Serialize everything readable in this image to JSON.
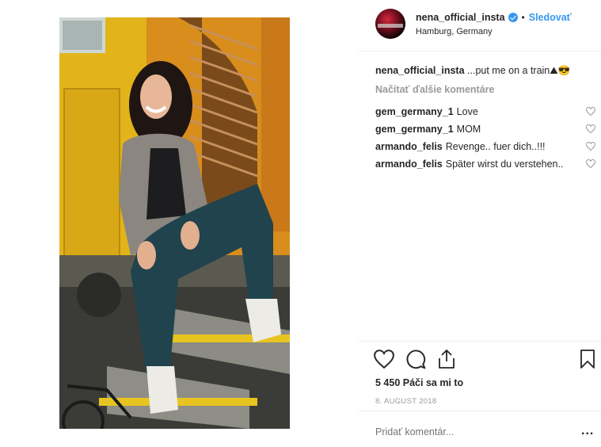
{
  "post": {
    "username": "nena_official_insta",
    "dot": "•",
    "follow_label": "Sledovať",
    "location": "Hamburg, Germany",
    "caption_text": "...put me on a train",
    "caption_emoji": "⛰😎",
    "load_more": "Načítať ďalšie komentáre",
    "comments": [
      {
        "user": "gem_germany_1",
        "text": "Love"
      },
      {
        "user": "gem_germany_1",
        "text": "MOM"
      },
      {
        "user": "armando_felis",
        "text": "Revenge.. fuer dich..!!!"
      },
      {
        "user": "armando_felis",
        "text": "Später wirst du verstehen.."
      }
    ],
    "likes": "5 450 Páči sa mi to",
    "date": "8. AUGUST 2018",
    "add_comment_placeholder": "Pridať komentár...",
    "more_label": "..."
  },
  "icons": {
    "like": "heart-icon",
    "comment": "comment-icon",
    "share": "share-icon",
    "save": "bookmark-icon",
    "verified": "verified-badge-icon"
  },
  "colors": {
    "link": "#3897f0",
    "muted": "#999999",
    "text": "#262626"
  }
}
